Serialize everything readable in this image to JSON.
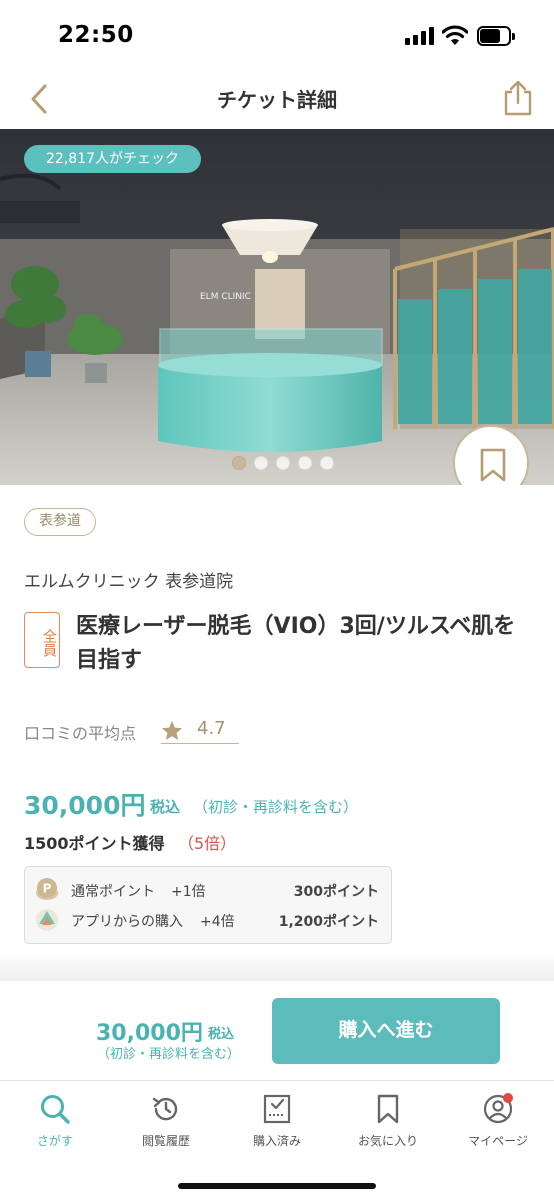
{
  "status_bar": {
    "time": "22:50"
  },
  "header": {
    "title": "チケット詳細"
  },
  "hero": {
    "check_badge": "22,817人がチェック",
    "photo_count": 5,
    "active_photo": 1
  },
  "ticket": {
    "area_tag": "表参道",
    "clinic_name": "エルムクリニック 表参道院",
    "badge": "全員",
    "title": "医療レーザー脱毛（VIO）3回/ツルスベ肌を目指す"
  },
  "review": {
    "label": "口コミの平均点",
    "score": "4.7"
  },
  "price": {
    "amount": "30,000円",
    "tax": "税込",
    "note": "（初診・再診料を含む）",
    "points_earn": "1500ポイント獲得",
    "points_multiplier": "（5倍）"
  },
  "points_breakdown": [
    {
      "icon": "point-coin-icon",
      "label": "通常ポイント",
      "mult": "+1倍",
      "amount": "300ポイント"
    },
    {
      "icon": "app-purchase-icon",
      "label": "アプリからの購入",
      "mult": "+4倍",
      "amount": "1,200ポイント"
    }
  ],
  "buy_bar": {
    "price": "30,000円",
    "tax": "税込",
    "note": "（初診・再診料を含む）",
    "button": "購入へ進む"
  },
  "tabs": [
    {
      "label": "さがす",
      "icon": "search-icon",
      "active": true
    },
    {
      "label": "閲覧履歴",
      "icon": "history-icon",
      "active": false
    },
    {
      "label": "購入済み",
      "icon": "purchased-icon",
      "active": false
    },
    {
      "label": "お気に入り",
      "icon": "bookmark-icon",
      "active": false
    },
    {
      "label": "マイページ",
      "icon": "mypage-icon",
      "active": false,
      "notification_dot": true
    }
  ],
  "colors": {
    "accent": "#4ab3b1",
    "gold": "#c7b494",
    "badge_orange": "#e07a45",
    "multiplier_red": "#d9534f",
    "notification": "#e04a3f"
  }
}
